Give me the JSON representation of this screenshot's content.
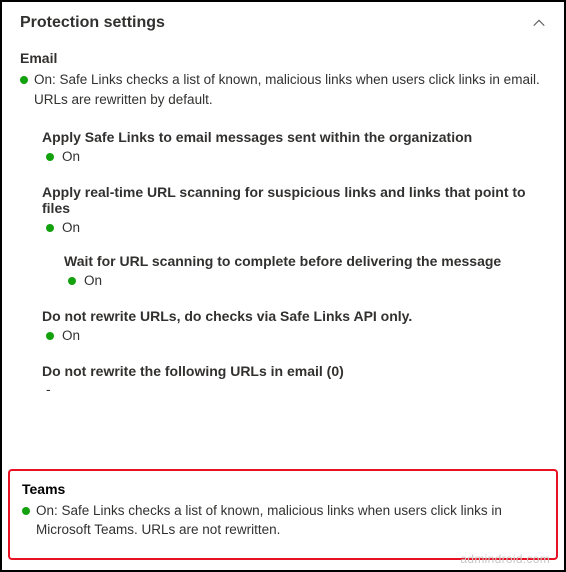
{
  "header": {
    "title": "Protection settings"
  },
  "email": {
    "label": "Email",
    "status_text": "On: Safe Links checks a list of known, malicious links when users click links in email. URLs are rewritten by default.",
    "items": [
      {
        "title": "Apply Safe Links to email messages sent within the organization",
        "status": "On"
      },
      {
        "title": "Apply real-time URL scanning for suspicious links and links that point to files",
        "status": "On",
        "nested": {
          "title": "Wait for URL scanning to complete before delivering the message",
          "status": "On"
        }
      },
      {
        "title": "Do not rewrite URLs, do checks via Safe Links API only.",
        "status": "On"
      },
      {
        "title": "Do not rewrite the following URLs in email (0)",
        "dash": "-"
      }
    ]
  },
  "teams": {
    "label": "Teams",
    "status_text": "On: Safe Links checks a list of known, malicious links when users click links in Microsoft Teams. URLs are not rewritten."
  },
  "watermark": "admindroid.com"
}
